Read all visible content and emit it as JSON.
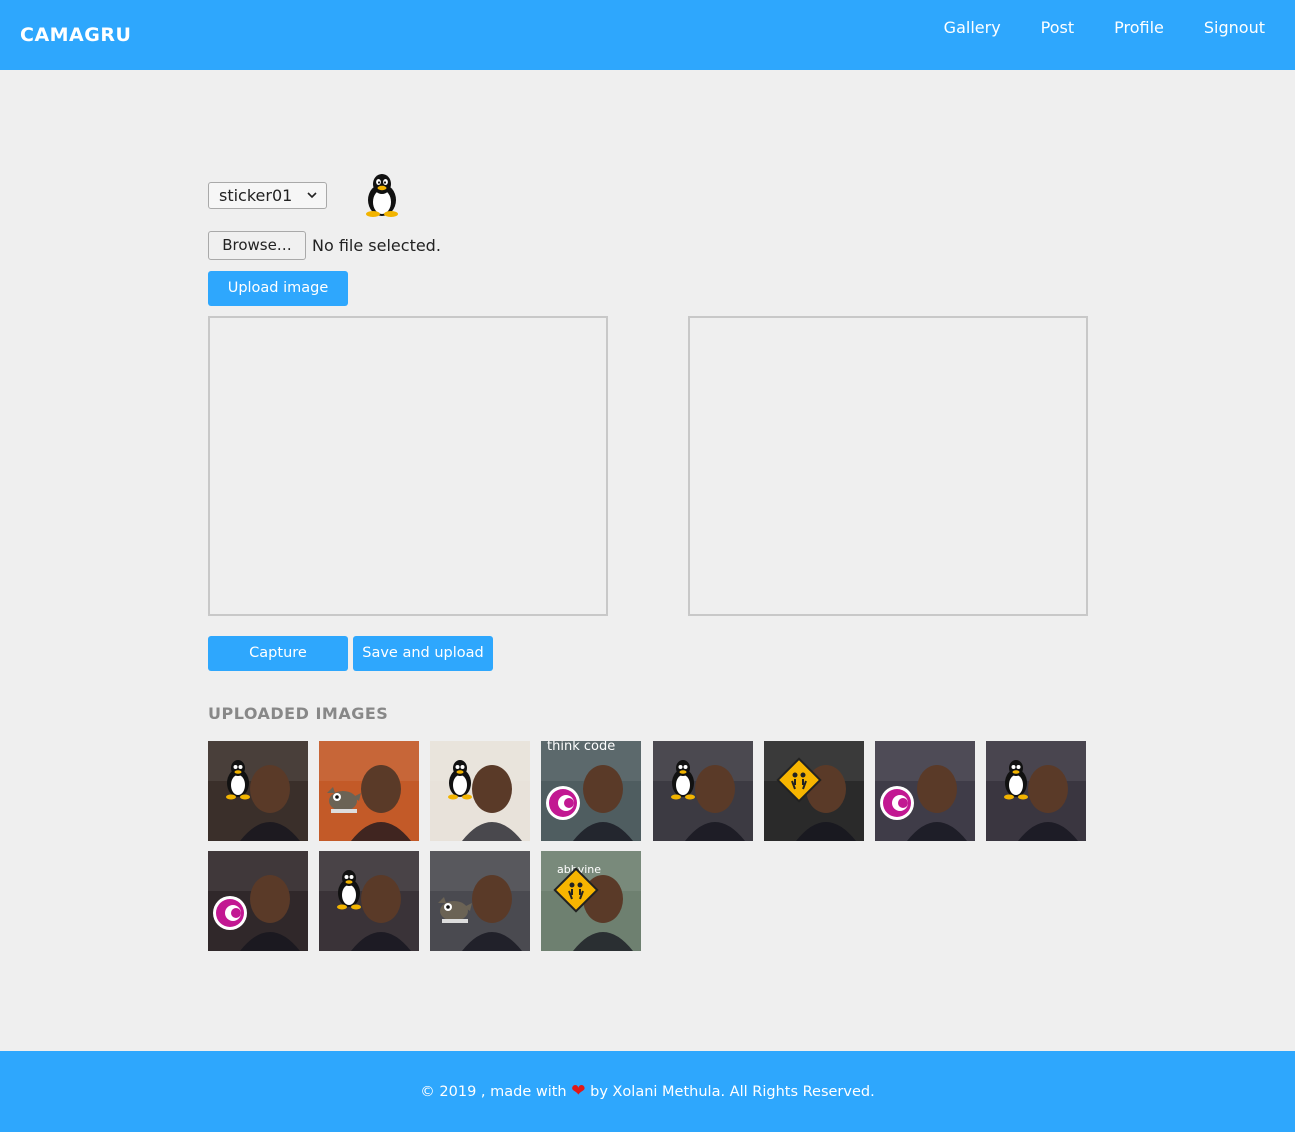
{
  "navbar": {
    "brand": "CAMAGRU",
    "links": [
      "Gallery",
      "Post",
      "Profile",
      "Signout"
    ]
  },
  "editor": {
    "sticker_select": {
      "selected": "sticker01",
      "chevron_icon": "chevron-down-icon"
    },
    "sticker_preview_icon": "tux-penguin-icon",
    "browse_label": "Browse…",
    "file_status": "No file selected.",
    "upload_label": "Upload image",
    "capture_label": "Capture",
    "save_label": "Save and upload"
  },
  "uploaded": {
    "heading": "UPLOADED IMAGES",
    "thumbs": [
      {
        "sticker": "penguin",
        "bg": "#3a2f2a"
      },
      {
        "sticker": "gimp",
        "bg": "#c35a28"
      },
      {
        "sticker": "penguin",
        "bg": "#e8e2da"
      },
      {
        "sticker": "swirl",
        "bg": "#4f5d60"
      },
      {
        "sticker": "penguin",
        "bg": "#3c3a42"
      },
      {
        "sticker": "sign",
        "bg": "#2a2a2a"
      },
      {
        "sticker": "swirl",
        "bg": "#3f3c48"
      },
      {
        "sticker": "penguin",
        "bg": "#3a3640"
      },
      {
        "sticker": "swirl",
        "bg": "#30282a"
      },
      {
        "sticker": "penguin",
        "bg": "#3a3338"
      },
      {
        "sticker": "gimp",
        "bg": "#4a4a50"
      },
      {
        "sticker": "sign",
        "bg": "#6e8070"
      }
    ],
    "thumb_text_3": "think code",
    "thumb_text_11": "abbvine"
  },
  "footer": {
    "text_before": "© 2019 , made with ",
    "heart_icon": "heart-icon",
    "text_after": " by Xolani Methula. All Rights Reserved."
  },
  "colors": {
    "primary": "#2ea7fd",
    "background": "#efefef",
    "heart": "#e01818"
  }
}
